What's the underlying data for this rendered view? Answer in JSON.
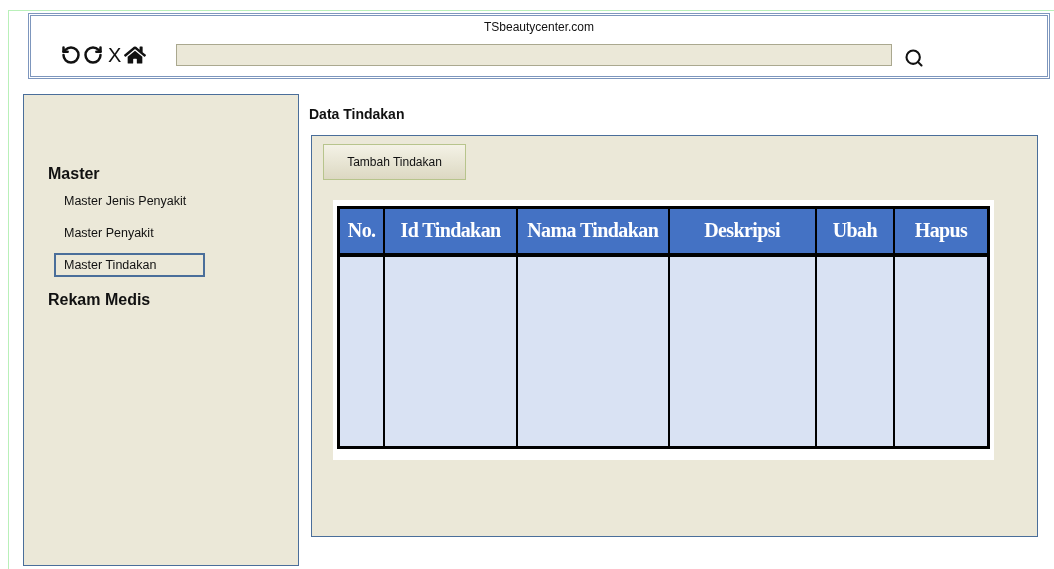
{
  "browser": {
    "site_title": "TSbeautycenter.com",
    "stop_label": "X"
  },
  "sidebar": {
    "sections": [
      {
        "heading": "Master",
        "items": [
          {
            "label": "Master Jenis Penyakit",
            "selected": false
          },
          {
            "label": "Master Penyakit",
            "selected": false
          },
          {
            "label": "Master Tindakan",
            "selected": true
          }
        ]
      },
      {
        "heading": "Rekam Medis"
      }
    ]
  },
  "page_title": "Data Tindakan",
  "add_button": "Tambah Tindakan",
  "table": {
    "columns": [
      "No.",
      "Id Tindakan",
      "Nama Tindakan",
      "Deskripsi",
      "Ubah",
      "Hapus"
    ]
  }
}
